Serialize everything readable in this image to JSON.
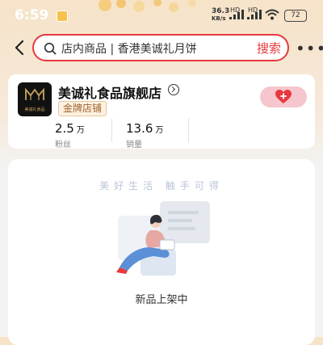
{
  "status_bar": {
    "time": "6:59",
    "net_speed_top": "36.3",
    "net_speed_bottom": "KB/s",
    "hd_1": "HD",
    "hd_2": "HD",
    "battery": "72"
  },
  "search": {
    "text": "店内商品 | 香港美诚礼月饼",
    "button_label": "搜索"
  },
  "store": {
    "name": "美诚礼食品旗舰店",
    "badge": "金牌店铺",
    "logo_text": "美诚礼食品",
    "stats": [
      {
        "value": "2.5",
        "unit": "万",
        "label": "粉丝"
      },
      {
        "value": "13.6",
        "unit": "万",
        "label": "销量"
      }
    ]
  },
  "empty_state": {
    "slogan": "美好生活 触手可得",
    "message": "新品上架中"
  },
  "colors": {
    "accent": "#e8383d",
    "badge_text": "#a0622a"
  },
  "icons": {
    "back": "chevron-left-icon",
    "search": "search-icon",
    "more": "more-icon",
    "follow": "heart-plus-icon"
  }
}
